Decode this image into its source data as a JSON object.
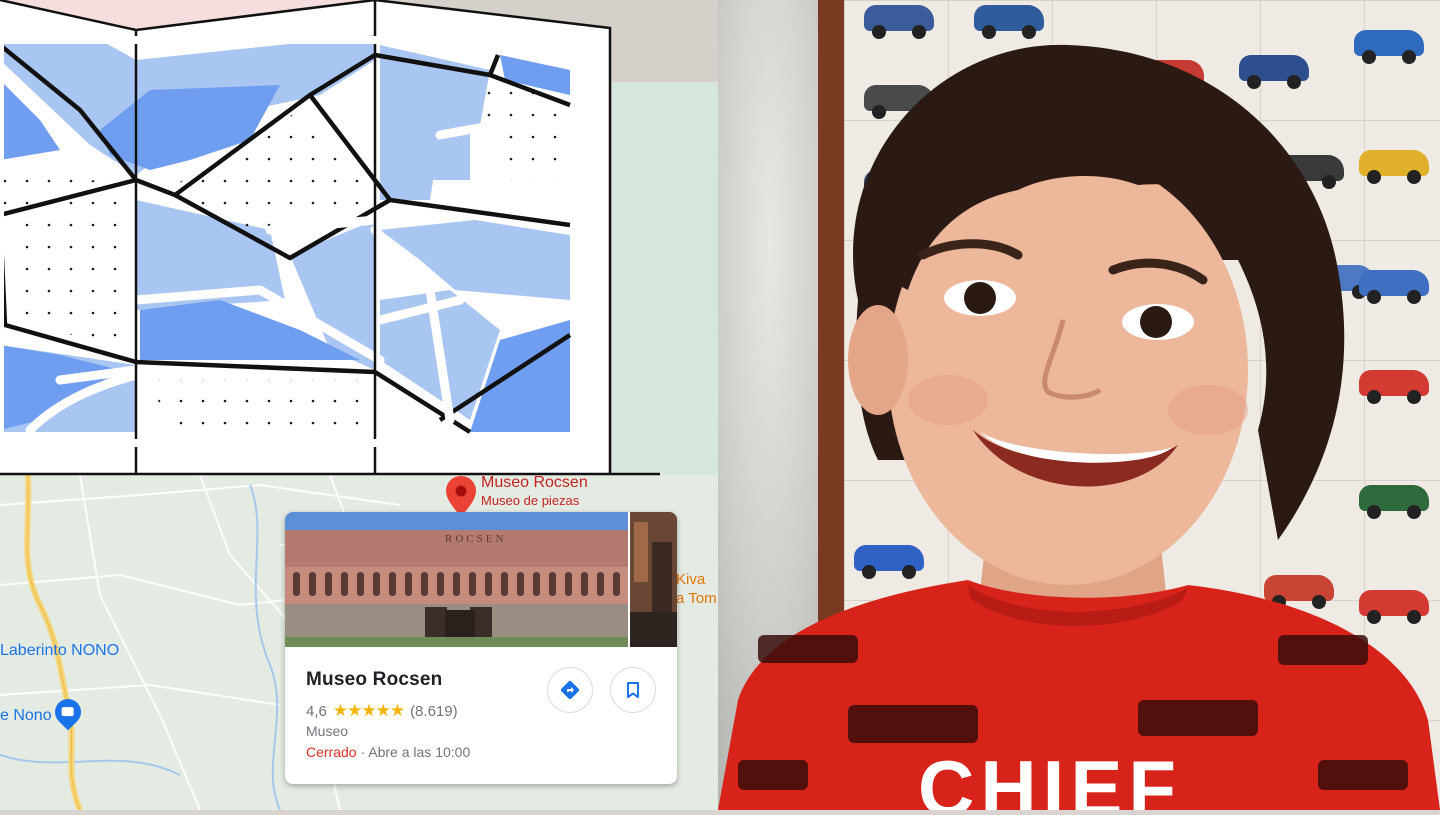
{
  "map": {
    "pin_title": "Museo Rocsen",
    "pin_subtitle": "Museo de piezas",
    "labels": {
      "laberinto": "Laberinto NONO",
      "nono": "e Nono",
      "kiva_line1": "Kiva",
      "kiva_line2": "a Tom"
    }
  },
  "card": {
    "facade_text": "ROCSEN",
    "title": "Museo Rocsen",
    "rating": "4,6",
    "stars": "★★★★★",
    "reviews": "(8.619)",
    "category": "Museo",
    "status_closed": "Cerrado",
    "separator": " · ",
    "opens": "Abre a las 10:00",
    "directions_icon": "directions-icon",
    "save_icon": "bookmark-icon"
  },
  "photo": {
    "shirt_text": "CHIEF"
  },
  "colors": {
    "map_water": "#a9c5f2",
    "map_water_dark": "#6f9ef0",
    "map_green": "#e4ebe3",
    "pin_red": "#ea4335",
    "shirt_red": "#d8231a",
    "star_yellow": "#f4b400",
    "link_blue": "#1a73e8"
  }
}
